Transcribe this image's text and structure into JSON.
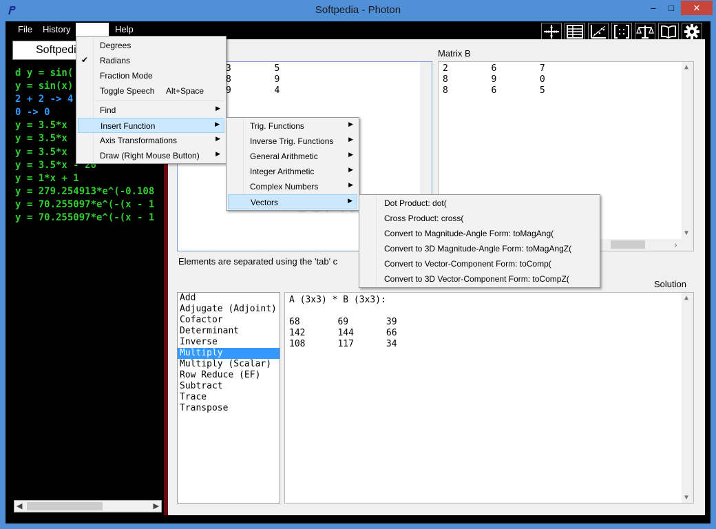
{
  "window": {
    "title": "Softpedia - Photon",
    "min_glyph": "–",
    "max_glyph": "□",
    "close_glyph": "✕"
  },
  "menubar": {
    "file": "File",
    "history": "History",
    "help": "Help"
  },
  "toolbar": [
    "crosshair-axes-icon",
    "table-icon",
    "scatter-plot-icon",
    "bracket-matrix-icon",
    "balance-scale-icon",
    "open-book-icon",
    "gear-icon"
  ],
  "console": {
    "input": "Softpedia",
    "lines": [
      {
        "text": "d y = sin(",
        "color": "#33cc33"
      },
      {
        "text": "y = sin(x)",
        "color": "#33cc33"
      },
      {
        "text": "2 + 2 -> 4",
        "color": "#3399ff"
      },
      {
        "text": "0 -> 0",
        "color": "#3399ff"
      },
      {
        "text": "y = 3.5*x",
        "color": "#33cc33"
      },
      {
        "text": "y = 3.5*x",
        "color": "#33cc33"
      },
      {
        "text": "y = 3.5*x",
        "color": "#33cc33"
      },
      {
        "text": "y = 3.5*x - 20",
        "color": "#33cc33"
      },
      {
        "text": "y = 1*x + 1",
        "color": "#33cc33"
      },
      {
        "text": "y = 279.254913*e^(-0.108",
        "color": "#33cc33"
      },
      {
        "text": "y = 70.255097*e^(-(x - 1",
        "color": "#33cc33"
      },
      {
        "text": "y = 70.255097*e^(-(x - 1",
        "color": "#33cc33"
      }
    ]
  },
  "matrixA": {
    "rows": [
      "3        5",
      "8        9",
      "9        4"
    ]
  },
  "matrixB": {
    "label": "Matrix B",
    "rows": [
      "2        6        7",
      "8        9        0",
      "8        6        5"
    ]
  },
  "hint": "Elements are separated using the 'tab' c",
  "solution": {
    "label": "Solution",
    "lines": [
      "A (3x3) * B (3x3):",
      "",
      "68       69       39",
      "142      144      66",
      "108      117      34"
    ]
  },
  "operations": {
    "items": [
      "Add",
      "Adjugate (Adjoint)",
      "Cofactor",
      "Determinant",
      "Inverse",
      "Multiply",
      "Multiply (Scalar)",
      "Row Reduce (EF)",
      "Subtract",
      "Trace",
      "Transpose"
    ],
    "selected": "Multiply"
  },
  "options_menu": {
    "items": [
      {
        "label": "Degrees"
      },
      {
        "label": "Radians",
        "checked": true
      },
      {
        "label": "Fraction Mode"
      },
      {
        "label": "Toggle Speech",
        "accel": "Alt+Space"
      },
      {
        "label": "Find",
        "submenu": true
      },
      {
        "label": "Insert Function",
        "submenu": true,
        "highlighted": true
      },
      {
        "label": "Axis Transformations",
        "submenu": true
      },
      {
        "label": "Draw (Right Mouse Button)",
        "submenu": true
      }
    ]
  },
  "insert_menu": {
    "items": [
      "Trig. Functions",
      "Inverse Trig. Functions",
      "General Arithmetic",
      "Integer Arithmetic",
      "Complex Numbers",
      "Vectors"
    ],
    "highlighted": "Vectors"
  },
  "vectors_menu": {
    "items": [
      "Dot Product: dot(",
      "Cross Product: cross(",
      "Convert to Magnitude-Angle Form: toMagAng(",
      "Convert to 3D Magnitude-Angle Form: toMagAngZ(",
      "Convert to Vector-Component Form: toComp(",
      "Convert to 3D Vector-Component Form: toCompZ("
    ]
  },
  "watermark": "SOFTPEDIA",
  "colors": {
    "accent": "#3399ff",
    "console_green": "#33cc33",
    "console_blue": "#3399ff",
    "splitter": "#6a0a10",
    "menu_highlight": "#cce8ff"
  }
}
